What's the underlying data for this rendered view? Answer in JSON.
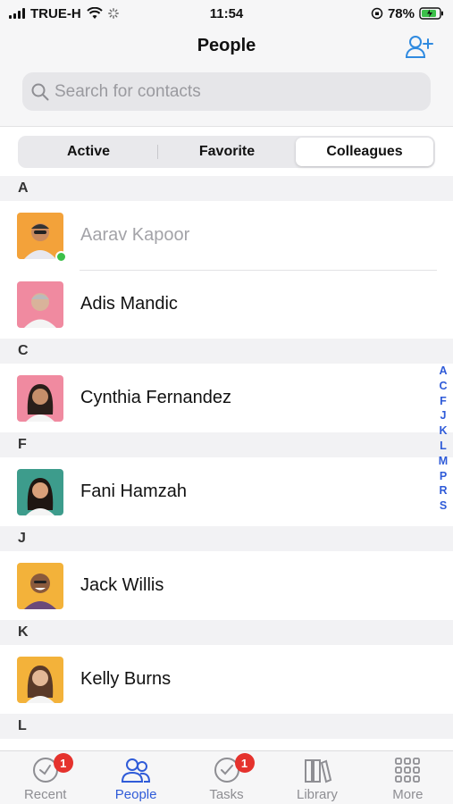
{
  "status_bar": {
    "carrier": "TRUE-H",
    "time": "11:54",
    "battery_percent": "78%"
  },
  "header": {
    "title": "People",
    "add_icon": "add-person-icon"
  },
  "search": {
    "placeholder": "Search for contacts",
    "icon": "search-icon"
  },
  "segments": {
    "items": [
      "Active",
      "Favorite",
      "Colleagues"
    ],
    "selected": "Colleagues"
  },
  "sections": [
    {
      "letter": "A",
      "contacts": [
        {
          "name": "Aarav Kapoor",
          "online": true,
          "dimmed": true
        },
        {
          "name": "Adis Mandic",
          "online": false,
          "dimmed": false
        }
      ]
    },
    {
      "letter": "C",
      "contacts": [
        {
          "name": "Cynthia Fernandez",
          "online": false,
          "dimmed": false
        }
      ]
    },
    {
      "letter": "F",
      "contacts": [
        {
          "name": "Fani Hamzah",
          "online": false,
          "dimmed": false
        }
      ]
    },
    {
      "letter": "J",
      "contacts": [
        {
          "name": "Jack Willis",
          "online": false,
          "dimmed": false
        }
      ]
    },
    {
      "letter": "K",
      "contacts": [
        {
          "name": "Kelly Burns",
          "online": false,
          "dimmed": false
        }
      ]
    },
    {
      "letter": "L",
      "contacts": []
    }
  ],
  "alpha_index": [
    "A",
    "C",
    "F",
    "J",
    "K",
    "L",
    "M",
    "P",
    "R",
    "S"
  ],
  "tab_bar": {
    "items": [
      {
        "label": "Recent",
        "icon": "clock-icon",
        "badge": "1",
        "active": false
      },
      {
        "label": "People",
        "icon": "people-icon",
        "badge": "",
        "active": true
      },
      {
        "label": "Tasks",
        "icon": "check-circle-icon",
        "badge": "1",
        "active": false
      },
      {
        "label": "Library",
        "icon": "books-icon",
        "badge": "",
        "active": false
      },
      {
        "label": "More",
        "icon": "grid-icon",
        "badge": "",
        "active": false
      }
    ]
  },
  "colors": {
    "accent": "#2f5bd8",
    "online": "#3cc04a",
    "badge": "#e5322d"
  }
}
